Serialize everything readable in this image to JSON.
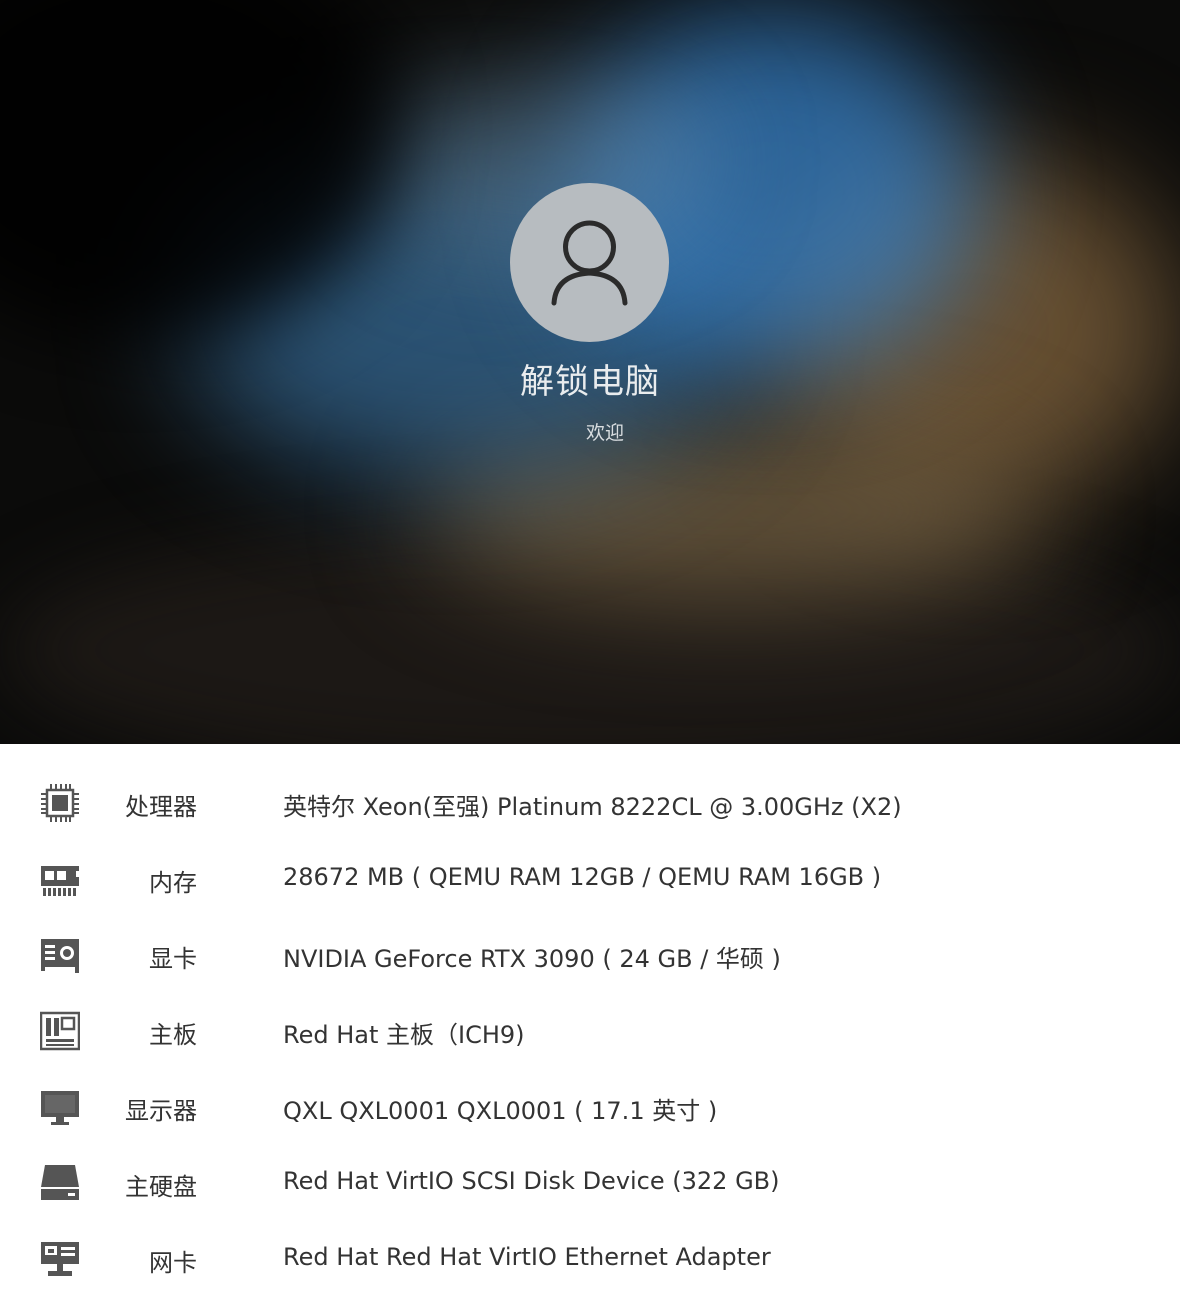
{
  "lock_screen": {
    "title": "解锁电脑",
    "subtitle": "欢迎"
  },
  "specs": [
    {
      "icon": "cpu-icon",
      "label": "处理器",
      "value": "英特尔 Xeon(至强) Platinum 8222CL @ 3.00GHz (X2)"
    },
    {
      "icon": "memory-icon",
      "label": "内存",
      "value": "28672 MB ( QEMU RAM 12GB / QEMU RAM 16GB )"
    },
    {
      "icon": "graphics-card-icon",
      "label": "显卡",
      "value": "NVIDIA GeForce RTX 3090 ( 24 GB / 华硕 )"
    },
    {
      "icon": "motherboard-icon",
      "label": "主板",
      "value": "Red Hat 主板（ICH9)"
    },
    {
      "icon": "monitor-icon",
      "label": "显示器",
      "value": "QXL QXL0001 QXL0001 ( 17.1 英寸 )"
    },
    {
      "icon": "hard-disk-icon",
      "label": "主硬盘",
      "value": "Red Hat VirtIO SCSI Disk Device (322 GB)"
    },
    {
      "icon": "network-card-icon",
      "label": "网卡",
      "value": "Red Hat Red Hat VirtIO Ethernet Adapter"
    }
  ],
  "colors": {
    "avatar_bg": "#b7bcc0",
    "icon": "#555555",
    "text": "#333333"
  }
}
